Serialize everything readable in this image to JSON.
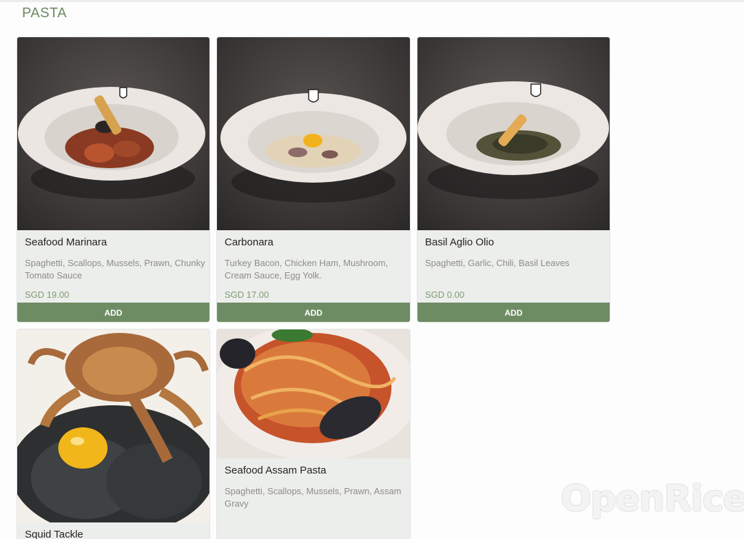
{
  "section": {
    "title": "PASTA"
  },
  "items": [
    {
      "name": "Seafood Marinara",
      "description": "Spaghetti, Scallops, Mussels, Prawn, Chunky Tomato Sauce",
      "price": "SGD 19.00",
      "add_label": "ADD"
    },
    {
      "name": "Carbonara",
      "description": "Turkey Bacon, Chicken Ham, Mushroom, Cream Sauce, Egg Yolk.",
      "price": "SGD 17.00",
      "add_label": "ADD"
    },
    {
      "name": "Basil Aglio Olio",
      "description": "Spaghetti, Garlic, Chili, Basil Leaves",
      "price": "SGD 0.00",
      "add_label": "ADD"
    },
    {
      "name": "Squid Tackle"
    },
    {
      "name": "Seafood Assam Pasta",
      "description": "Spaghetti, Scallops, Mussels, Prawn, Assam Gravy"
    }
  ],
  "watermark": {
    "text": "OpenRice"
  },
  "colors": {
    "accent": "#6e8c63",
    "title": "#6b8a62",
    "card_bg": "#eceeeb"
  }
}
